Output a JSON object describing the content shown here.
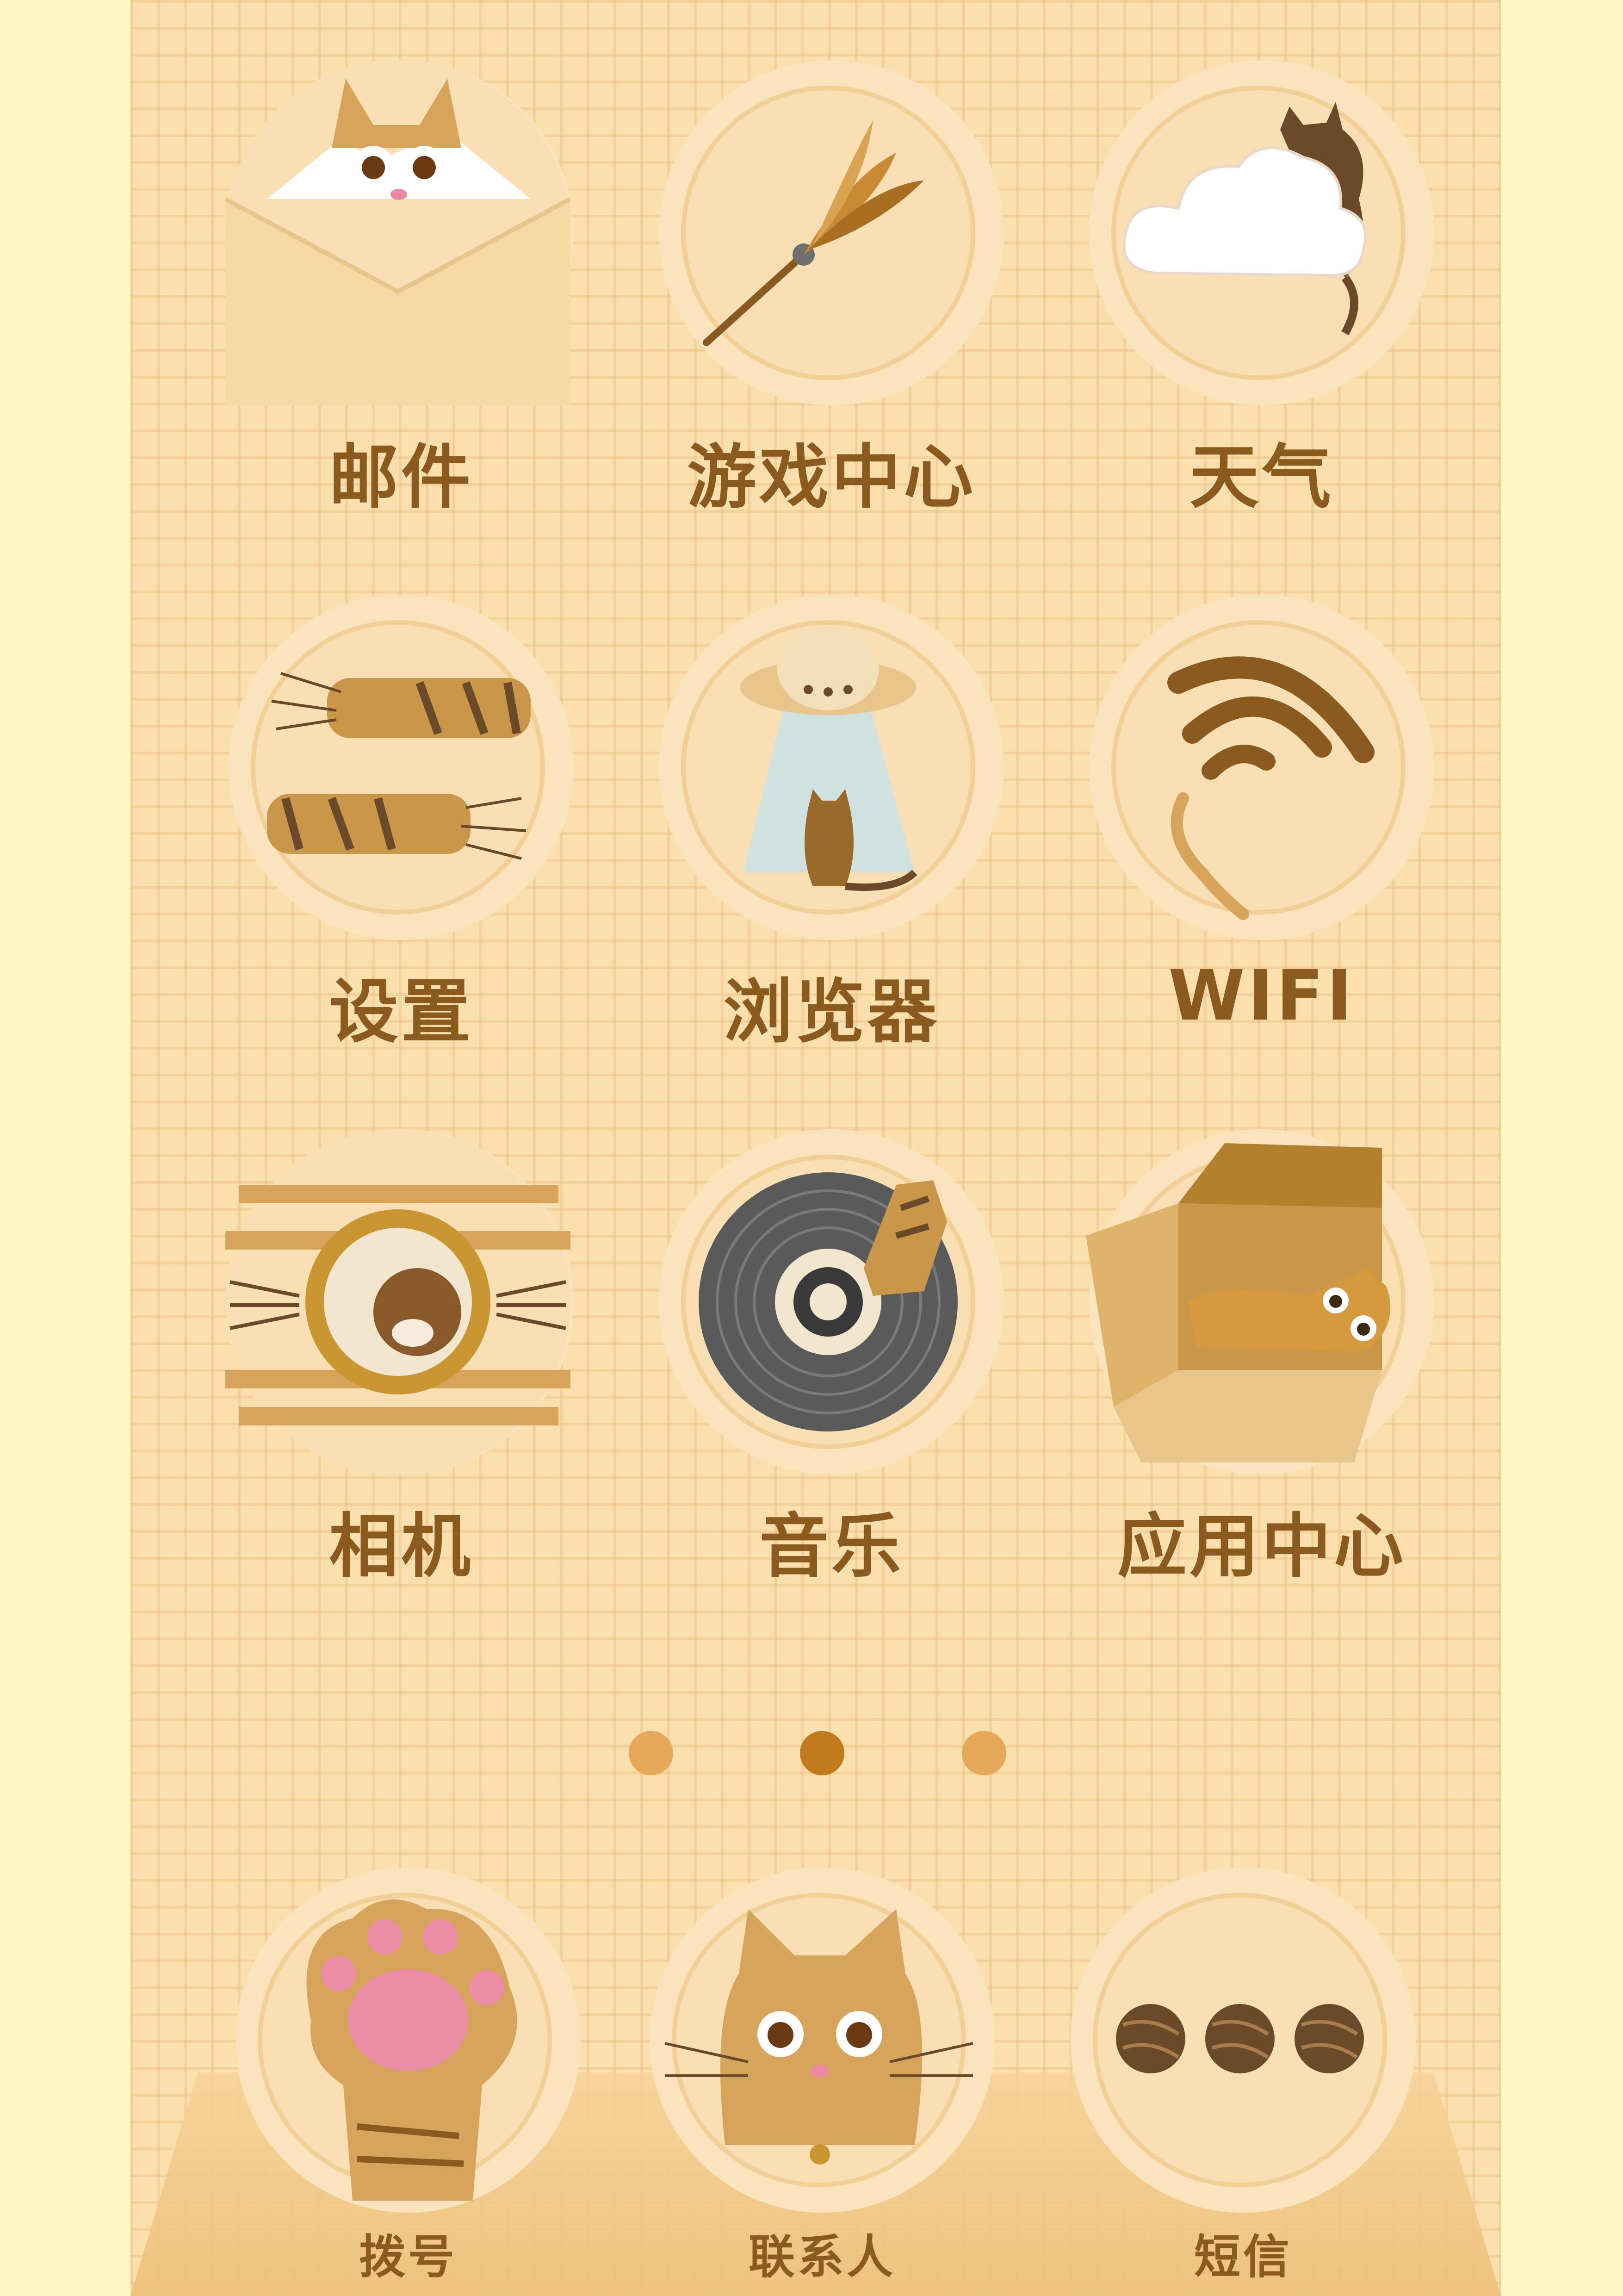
{
  "theme": {
    "background": "#fdf7c3",
    "screen_bg": "#fbe0ad",
    "label_color": "#8a5a1e",
    "dot_active": "#c17a1c",
    "dot_inactive": "#e6a85a"
  },
  "home_grid": [
    {
      "label": "邮件",
      "icon": "cat-envelope-icon"
    },
    {
      "label": "游戏中心",
      "icon": "feather-wand-icon"
    },
    {
      "label": "天气",
      "icon": "cloud-cat-icon"
    },
    {
      "label": "设置",
      "icon": "scratched-sticks-icon"
    },
    {
      "label": "浏览器",
      "icon": "ufo-cat-icon"
    },
    {
      "label": "WIFI",
      "icon": "wifi-tail-icon"
    },
    {
      "label": "相机",
      "icon": "camera-lens-icon"
    },
    {
      "label": "音乐",
      "icon": "vinyl-paw-icon"
    },
    {
      "label": "应用中心",
      "icon": "cat-in-box-icon"
    }
  ],
  "page_indicator": {
    "count": 3,
    "active_index": 1
  },
  "dock": [
    {
      "label": "拨号",
      "icon": "paw-dialer-icon"
    },
    {
      "label": "联系人",
      "icon": "cat-face-icon"
    },
    {
      "label": "短信",
      "icon": "yarn-balls-icon"
    }
  ]
}
